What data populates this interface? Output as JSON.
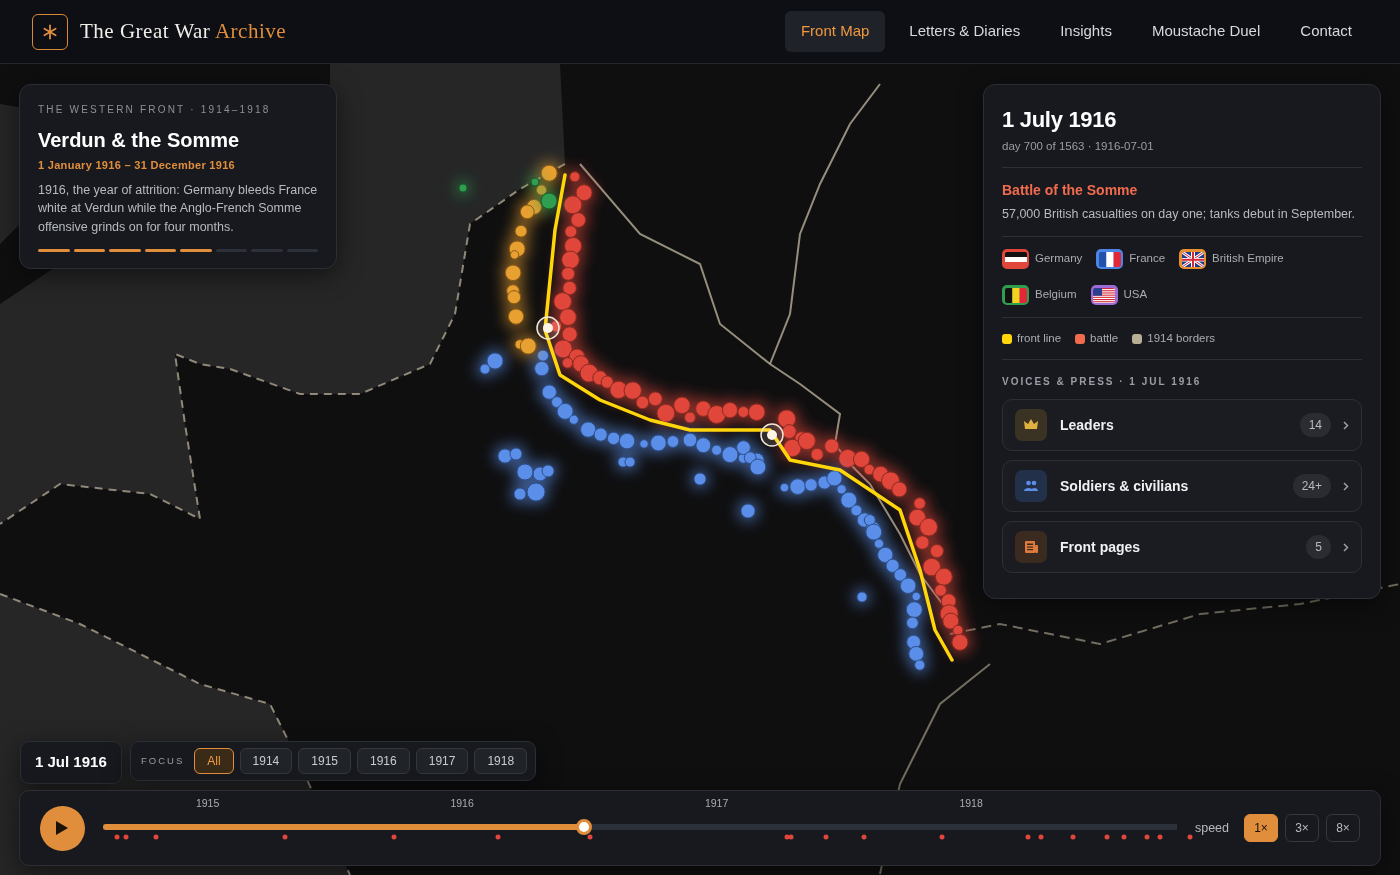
{
  "brand": {
    "title": "The Great War",
    "accent": "Archive"
  },
  "nav": [
    {
      "label": "Front Map",
      "selected": true
    },
    {
      "label": "Letters & Diaries",
      "selected": false
    },
    {
      "label": "Insights",
      "selected": false
    },
    {
      "label": "Moustache Duel",
      "selected": false
    },
    {
      "label": "Contact",
      "selected": false
    }
  ],
  "intro": {
    "eyebrow": "THE WESTERN FRONT · 1914–1918",
    "title": "Verdun & the Somme",
    "dates": "1 January 1916 – 31 December 1916",
    "text": "1916, the year of attrition: Germany bleeds France white at Verdun while the Anglo-French Somme offensive grinds on for four months.",
    "steps": [
      {
        "done": true
      },
      {
        "done": true
      },
      {
        "done": true
      },
      {
        "done": true
      },
      {
        "done": true
      },
      {
        "done": false
      },
      {
        "done": false
      },
      {
        "done": false
      }
    ]
  },
  "day": {
    "title": "1 July 1916",
    "meta": "day 700 of 1563 · 1916-07-01",
    "event_title": "Battle of the Somme",
    "event_text": "57,000 British casualties on day one; tanks debut in September.",
    "nations": [
      {
        "name": "Germany",
        "kind": "germany",
        "color": "#e0463a"
      },
      {
        "name": "France",
        "kind": "france",
        "color": "#4a86e8"
      },
      {
        "name": "British Empire",
        "kind": "union",
        "color": "#e8902f"
      },
      {
        "name": "Belgium",
        "kind": "belgium",
        "color": "#2f9e4f"
      },
      {
        "name": "USA",
        "kind": "usa",
        "color": "#9b6cd6"
      }
    ],
    "legend": [
      {
        "label": "front line",
        "color": "#ffd60a"
      },
      {
        "label": "battle",
        "color": "#f26b4f"
      },
      {
        "label": "1914 borders",
        "color": "#b8ae98"
      }
    ],
    "voices_heading": "VOICES & PRESS · 1 JUL 1916",
    "voices": [
      {
        "label": "Leaders",
        "count": "14",
        "kind": "crown"
      },
      {
        "label": "Soldiers & civilians",
        "count": "24+",
        "kind": "people"
      },
      {
        "label": "Front pages",
        "count": "5",
        "kind": "newspaper"
      }
    ]
  },
  "date_chip": "1 Jul 1916",
  "focus": {
    "label": "FOCUS",
    "options": [
      {
        "label": "All",
        "selected": true
      },
      {
        "label": "1914",
        "selected": false
      },
      {
        "label": "1915",
        "selected": false
      },
      {
        "label": "1916",
        "selected": false
      },
      {
        "label": "1917",
        "selected": false
      },
      {
        "label": "1918",
        "selected": false
      }
    ]
  },
  "timeline": {
    "level": 0.448,
    "ticks": [
      "1915",
      "1916",
      "1917",
      "1918"
    ],
    "speed_label": "speed",
    "speeds": [
      {
        "label": "1×",
        "selected": true
      },
      {
        "label": "3×",
        "selected": false
      },
      {
        "label": "8×",
        "selected": false
      }
    ]
  }
}
